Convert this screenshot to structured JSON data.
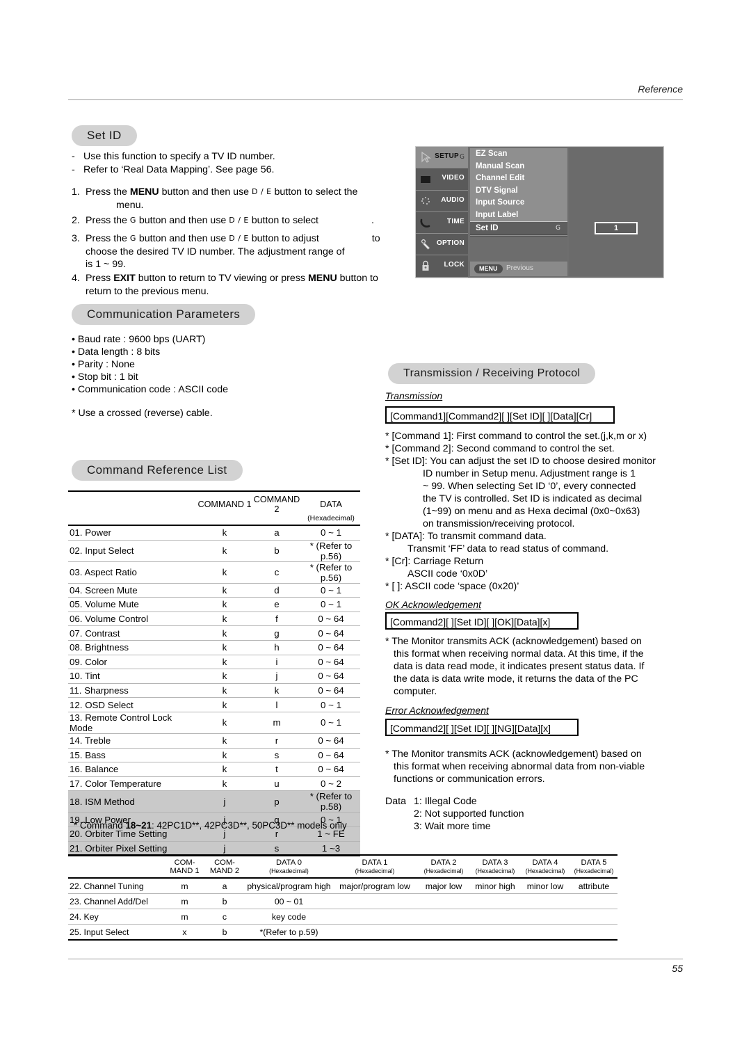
{
  "header": {
    "running_head": "Reference"
  },
  "footer": {
    "page_number": "55"
  },
  "set_id": {
    "heading": "Set ID",
    "bullets": [
      "Use this function to specify a TV ID number.",
      "Refer to ‘Real Data Mapping’. See page 56."
    ],
    "steps": [
      {
        "num": "1.",
        "parts": [
          "Press the ",
          "MENU",
          " button and then use ",
          "D",
          " / ",
          "E",
          "  button to select the menu."
        ]
      },
      {
        "num": "2.",
        "parts": [
          "Press the ",
          "G",
          " button and then use ",
          "D",
          " / ",
          "E",
          "  button to select           ."
        ]
      },
      {
        "num": "3.",
        "parts": [
          "Press the ",
          "G",
          "  button and then use ",
          "D",
          " / ",
          "E",
          " button to adjust              to choose the desired TV ID number. The adjustment range of          is 1 ~ 99."
        ]
      },
      {
        "num": "4.",
        "parts": [
          "Press ",
          "EXIT",
          " button to return to TV viewing or press ",
          "MENU",
          " button to return to the previous menu."
        ]
      }
    ],
    "step1_a": "Press the",
    "step1_b": "MENU",
    "step1_c": "button and then use",
    "step1_sym1": "D",
    "step1_slash": "/",
    "step1_sym2": "E",
    "step1_d": "button to select the",
    "step1_e": "menu.",
    "step2_a": "Press the",
    "step2_g": "G",
    "step2_b": "button and then use",
    "step2_sym1": "D",
    "step2_sym2": "E",
    "step2_c": "button to select",
    "step2_period": ".",
    "step3_a": "Press the",
    "step3_g": "G",
    "step3_b": "button and then use",
    "step3_sym1": "D",
    "step3_sym2": "E",
    "step3_c": "button to adjust",
    "step3_to": "to",
    "step3_d": "choose the desired TV ID number. The adjustment range of",
    "step3_e": "is 1 ~ 99.",
    "step4_a": "Press",
    "step4_exit": "EXIT",
    "step4_b": "button to return to TV viewing or press",
    "step4_menu": "MENU",
    "step4_c": "button to",
    "step4_d": "return to the previous menu.",
    "num1": "1.",
    "num2": "2.",
    "num3": "3.",
    "num4": "4.",
    "dash": "-"
  },
  "osd": {
    "side_items": [
      {
        "label": "SETUP",
        "icon": "cursor-arrow-icon",
        "selected": true,
        "g": "G"
      },
      {
        "label": "VIDEO",
        "icon": "screen-square-icon",
        "selected": false
      },
      {
        "label": "AUDIO",
        "icon": "sound-dots-icon",
        "selected": false
      },
      {
        "label": "TIME",
        "icon": "clock-arc-icon",
        "selected": false
      },
      {
        "label": "OPTION",
        "icon": "remote-control-icon",
        "selected": false
      },
      {
        "label": "LOCK",
        "icon": "padlock-icon",
        "selected": false
      }
    ],
    "menu_items": [
      {
        "label": "EZ Scan",
        "selected": false
      },
      {
        "label": "Manual Scan",
        "selected": false
      },
      {
        "label": "Channel Edit",
        "selected": false
      },
      {
        "label": "DTV Signal",
        "selected": false
      },
      {
        "label": "Input Source",
        "selected": false
      },
      {
        "label": "Input Label",
        "selected": false
      },
      {
        "label": "Set ID",
        "selected": true,
        "glyph": "G"
      }
    ],
    "value_box": "1",
    "footer_button": "MENU",
    "footer_label": "Previous"
  },
  "comm_params": {
    "heading": "Communication Parameters",
    "bullets": [
      "Baud rate : 9600 bps (UART)",
      "Data length : 8 bits",
      "Parity : None",
      "Stop bit : 1 bit",
      "Communication code : ASCII code"
    ],
    "note": "* Use a crossed (reverse) cable."
  },
  "command_reference": {
    "heading": "Command Reference List",
    "columns": [
      "",
      "COMMAND 1",
      "COMMAND 2",
      "DATA"
    ],
    "sub_columns": [
      "",
      "",
      "",
      "(Hexadecimal)"
    ],
    "rows": [
      {
        "no": "01.",
        "name": "Power",
        "c1": "k",
        "c2": "a",
        "data": "0 ~ 1",
        "shaded": false
      },
      {
        "no": "02.",
        "name": "Input Select",
        "c1": "k",
        "c2": "b",
        "data": "* (Refer to p.56)",
        "shaded": false
      },
      {
        "no": "03.",
        "name": "Aspect Ratio",
        "c1": "k",
        "c2": "c",
        "data": "* (Refer to p.56)",
        "shaded": false
      },
      {
        "no": "04.",
        "name": "Screen Mute",
        "c1": "k",
        "c2": "d",
        "data": "0 ~ 1",
        "shaded": false
      },
      {
        "no": "05.",
        "name": "Volume Mute",
        "c1": "k",
        "c2": "e",
        "data": "0 ~ 1",
        "shaded": false
      },
      {
        "no": "06.",
        "name": "Volume Control",
        "c1": "k",
        "c2": "f",
        "data": "0 ~ 64",
        "shaded": false
      },
      {
        "no": "07.",
        "name": "Contrast",
        "c1": "k",
        "c2": "g",
        "data": "0 ~ 64",
        "shaded": false
      },
      {
        "no": "08.",
        "name": "Brightness",
        "c1": "k",
        "c2": "h",
        "data": "0 ~ 64",
        "shaded": false
      },
      {
        "no": "09.",
        "name": "Color",
        "c1": "k",
        "c2": "i",
        "data": "0 ~ 64",
        "shaded": false
      },
      {
        "no": "10.",
        "name": "Tint",
        "c1": "k",
        "c2": "j",
        "data": "0 ~ 64",
        "shaded": false
      },
      {
        "no": "11.",
        "name": "Sharpness",
        "c1": "k",
        "c2": "k",
        "data": "0 ~ 64",
        "shaded": false
      },
      {
        "no": "12.",
        "name": "OSD Select",
        "c1": "k",
        "c2": "l",
        "data": "0 ~ 1",
        "shaded": false
      },
      {
        "no": "13.",
        "name": "Remote Control Lock Mode",
        "c1": "k",
        "c2": "m",
        "data": "0 ~ 1",
        "shaded": false
      },
      {
        "no": "14.",
        "name": "Treble",
        "c1": "k",
        "c2": "r",
        "data": "0 ~ 64",
        "shaded": false
      },
      {
        "no": "15.",
        "name": "Bass",
        "c1": "k",
        "c2": "s",
        "data": "0 ~ 64",
        "shaded": false
      },
      {
        "no": "16.",
        "name": "Balance",
        "c1": "k",
        "c2": "t",
        "data": "0 ~ 64",
        "shaded": false
      },
      {
        "no": "17.",
        "name": "Color Temperature",
        "c1": "k",
        "c2": "u",
        "data": "0 ~ 2",
        "shaded": false
      },
      {
        "no": "18.",
        "name": "ISM Method",
        "c1": "j",
        "c2": "p",
        "data": "* (Refer to p.58)",
        "shaded": true
      },
      {
        "no": "19.",
        "name": "Low Power",
        "c1": "j",
        "c2": "q",
        "data": "0 ~ 1",
        "shaded": true
      },
      {
        "no": "20.",
        "name": "Orbiter Time Setting",
        "c1": "j",
        "c2": "r",
        "data": "1 ~ FE",
        "shaded": true
      },
      {
        "no": "21.",
        "name": "Orbiter Pixel Setting",
        "c1": "j",
        "c2": "s",
        "data": "1 ~3",
        "shaded": true
      }
    ],
    "footnote_a": "* Command",
    "footnote_b": "18~21",
    "footnote_c": ": 42PC1D**, 42PC3D**, 50PC3D** models only"
  },
  "protocol": {
    "heading": "Transmission / Receiving  Protocol",
    "transmission_label": "Transmission",
    "transmission_format": "[Command1][Command2][  ][Set ID][  ][Data][Cr]",
    "transmission_notes": [
      "* [Command 1]: First command to control the set.(j,k,m or x)",
      "* [Command 2]: Second command to control the set.",
      "* [Set ID]: You can adjust the set ID to choose desired monitor",
      "ID number in Setup menu. Adjustment range is 1",
      "~ 99. When selecting Set ID ‘0’, every connected",
      "the TV is controlled. Set ID is indicated as decimal",
      "(1~99) on menu and as Hexa decimal (0x0~0x63)",
      "on transmission/receiving protocol.",
      "* [DATA]: To transmit command data.",
      "Transmit ‘FF’ data to read status of command.",
      "* [Cr]: Carriage Return",
      "ASCII code ‘0x0D’",
      "* [   ]: ASCII code ‘space (0x20)’"
    ],
    "ok_label": "OK Acknowledgement",
    "ok_format": "[Command2][  ][Set ID][  ][OK][Data][x]",
    "ok_notes": [
      "* The Monitor transmits ACK (acknowledgement) based on",
      "this format when receiving normal data. At this time, if the",
      "data is data read mode, it indicates present status data. If",
      "the data is data write mode, it returns the data of the PC",
      "computer."
    ],
    "error_label": "Error Acknowledgement",
    "error_format": "[Command2][  ][Set ID][  ][NG][Data][x]",
    "error_notes": [
      "* The Monitor transmits ACK (acknowledgement) based on",
      "this format when receiving abnormal data from non-viable",
      "functions or communication errors."
    ],
    "data_label": "Data",
    "data_codes": [
      "1: Illegal Code",
      "2: Not supported function",
      "3: Wait more time"
    ]
  },
  "channel_table": {
    "columns_line1": [
      "",
      "COM-",
      "COM-",
      "DATA 0",
      "DATA 1",
      "DATA 2",
      "DATA 3",
      "DATA 4",
      "DATA 5"
    ],
    "columns_line2": [
      "",
      "MAND 1",
      "MAND 2",
      "(Hexadecimal)",
      "(Hexadecimal)",
      "(Hexadecimal)",
      "(Hexadecimal)",
      "(Hexadecimal)",
      "(Hexadecimal)"
    ],
    "rows": [
      {
        "no": "22.",
        "name": "Channel Tuning",
        "c1": "m",
        "c2": "a",
        "d0": "physical/program high",
        "d1": "major/program low",
        "d2": "major low",
        "d3": "minor high",
        "d4": "minor low",
        "d5": "attribute"
      },
      {
        "no": "23.",
        "name": "Channel Add/Del",
        "c1": "m",
        "c2": "b",
        "d0": "00 ~ 01",
        "d1": "",
        "d2": "",
        "d3": "",
        "d4": "",
        "d5": ""
      },
      {
        "no": "24.",
        "name": "Key",
        "c1": "m",
        "c2": "c",
        "d0": "key code",
        "d1": "",
        "d2": "",
        "d3": "",
        "d4": "",
        "d5": ""
      },
      {
        "no": "25.",
        "name": "Input Select",
        "c1": "x",
        "c2": "b",
        "d0": "*(Refer to p.59)",
        "d1": "",
        "d2": "",
        "d3": "",
        "d4": "",
        "d5": ""
      }
    ]
  }
}
